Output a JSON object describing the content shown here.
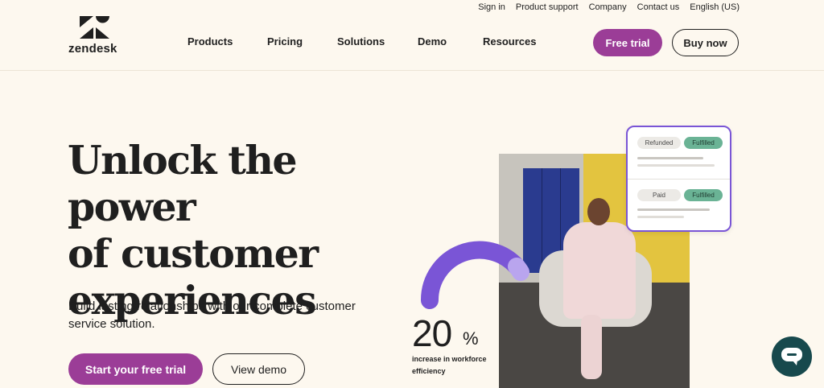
{
  "utility_nav": [
    "Sign in",
    "Product support",
    "Company",
    "Contact us",
    "English (US)"
  ],
  "logo": {
    "text": "zendesk"
  },
  "nav": [
    "Products",
    "Pricing",
    "Solutions",
    "Demo",
    "Resources"
  ],
  "header_buttons": {
    "free_trial": "Free trial",
    "buy_now": "Buy now"
  },
  "hero": {
    "title_lines": [
      "Unlock the power",
      "of customer",
      "experiences"
    ],
    "subtitle_lines": [
      "Build lasting relationships with our complete customer",
      "service solution."
    ],
    "cta_primary": "Start your free trial",
    "cta_secondary": "View demo"
  },
  "stat": {
    "value": "20",
    "unit": "%",
    "label_lines": [
      "increase in workforce",
      "efficiency"
    ]
  },
  "order_card": {
    "rows": [
      {
        "status": "Refunded",
        "badge": "Fulfilled"
      },
      {
        "status": "Paid",
        "badge": "Fulfilled"
      }
    ]
  },
  "colors": {
    "brand_purple": "#9b3d97",
    "accent_violet": "#7a55d6",
    "badge_green": "#6ab395",
    "chat_teal": "#17494d",
    "background": "#fdf8ef"
  },
  "icons": {
    "chat": "chat-bubble-icon",
    "logo": "zendesk-z-icon"
  }
}
